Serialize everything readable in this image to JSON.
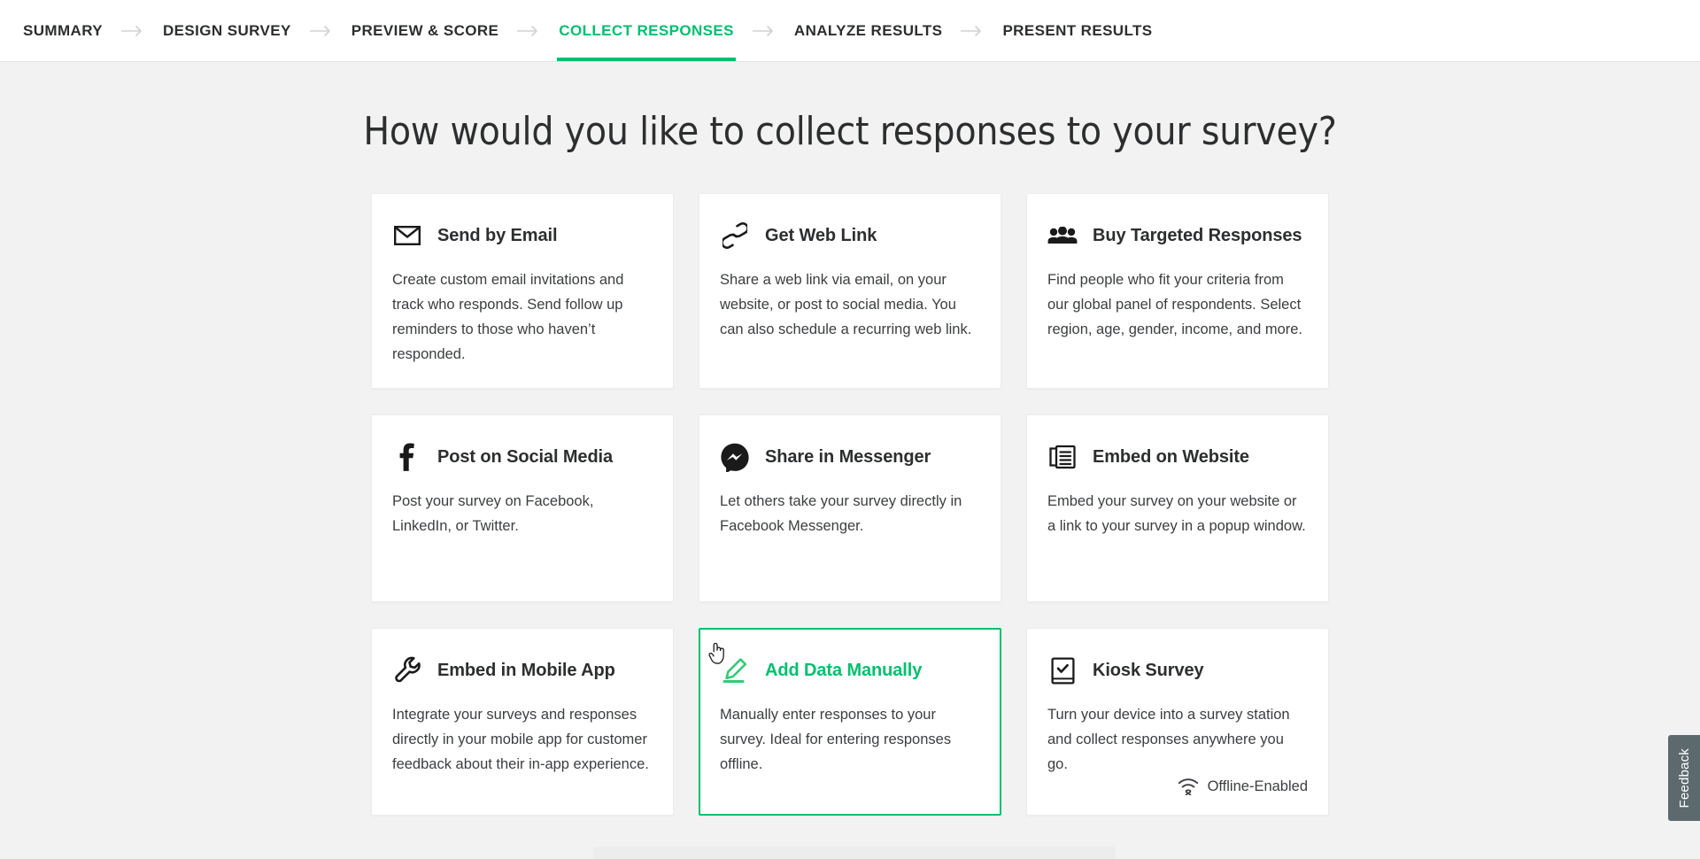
{
  "nav": {
    "items": [
      {
        "label": "SUMMARY",
        "active": false
      },
      {
        "label": "DESIGN SURVEY",
        "active": false
      },
      {
        "label": "PREVIEW & SCORE",
        "active": false
      },
      {
        "label": "COLLECT RESPONSES",
        "active": true
      },
      {
        "label": "ANALYZE RESULTS",
        "active": false
      },
      {
        "label": "PRESENT RESULTS",
        "active": false
      }
    ],
    "separator_icon": "arrow-right-icon",
    "active_color": "#00bf6f"
  },
  "main": {
    "title": "How would you like to collect responses to your survey?",
    "cards": [
      {
        "id": "send-by-email",
        "icon": "envelope-icon",
        "title": "Send by Email",
        "description": "Create custom email invitations and track who responds. Send follow up reminders to those who haven’t responded.",
        "selected": false
      },
      {
        "id": "get-web-link",
        "icon": "link-icon",
        "title": "Get Web Link",
        "description": "Share a web link via email, on your website, or post to social media. You can also schedule a recurring web link.",
        "selected": false
      },
      {
        "id": "buy-targeted-responses",
        "icon": "people-group-icon",
        "title": "Buy Targeted Responses",
        "description": "Find people who fit your criteria from our global panel of respondents. Select region, age, gender, income, and more.",
        "selected": false
      },
      {
        "id": "post-on-social-media",
        "icon": "facebook-f-icon",
        "title": "Post on Social Media",
        "description": "Post your survey on Facebook, LinkedIn, or Twitter.",
        "selected": false
      },
      {
        "id": "share-in-messenger",
        "icon": "messenger-icon",
        "title": "Share in Messenger",
        "description": "Let others take your survey directly in Facebook Messenger.",
        "selected": false
      },
      {
        "id": "embed-on-website",
        "icon": "embed-window-icon",
        "title": "Embed on Website",
        "description": "Embed your survey on your website or a link to your survey in a popup window.",
        "selected": false
      },
      {
        "id": "embed-in-mobile-app",
        "icon": "wrench-icon",
        "title": "Embed in Mobile App",
        "description": "Integrate your surveys and responses directly in your mobile app for customer feedback about their in-app experience.",
        "selected": false
      },
      {
        "id": "add-data-manually",
        "icon": "pencil-icon",
        "title": "Add Data Manually",
        "description": "Manually enter responses to your survey. Ideal for entering responses offline.",
        "selected": true
      },
      {
        "id": "kiosk-survey",
        "icon": "tablet-check-icon",
        "title": "Kiosk Survey",
        "description": "Turn your device into a survey station and collect responses anywhere you go.",
        "selected": false,
        "badge": {
          "icon": "wifi-off-icon",
          "label": "Offline-Enabled"
        }
      }
    ]
  },
  "feedback": {
    "label": "Feedback"
  },
  "cursor": {
    "icon": "pointing-hand-cursor"
  }
}
